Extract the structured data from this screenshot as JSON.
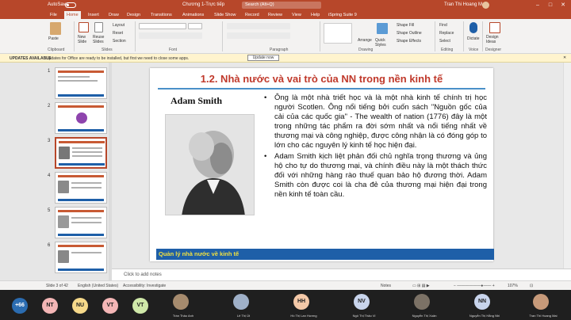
{
  "titlebar": {
    "autosave": "AutoSave",
    "autosave_state": "Off",
    "document": "Chương 1-Trực tiếp",
    "search": "Search (Alt+Q)",
    "user": "Tran Thi Hoang Mai"
  },
  "tabs": [
    "File",
    "Home",
    "Insert",
    "Draw",
    "Design",
    "Transitions",
    "Animations",
    "Slide Show",
    "Record",
    "Review",
    "View",
    "Help",
    "iSpring Suite 9"
  ],
  "ribbon": {
    "paste": "Paste",
    "new_slide": "New Slide",
    "reuse_slides": "Reuse Slides",
    "layout": "Layout",
    "reset": "Reset",
    "section": "Section",
    "shape_fill": "Shape Fill",
    "shape_outline": "Shape Outline",
    "shape_effects": "Shape Effects",
    "arrange": "Arrange",
    "quick_styles": "Quick Styles",
    "find": "Find",
    "replace": "Replace",
    "select": "Select",
    "dictate": "Dictate",
    "design_ideas": "Design Ideas",
    "groups": [
      "Clipboard",
      "Slides",
      "Font",
      "Paragraph",
      "Drawing",
      "Editing",
      "Voice",
      "Designer"
    ]
  },
  "update_bar": {
    "title": "UPDATES AVAILABLE",
    "message": "Updates for Office are ready to be installed, but first we need to close some apps.",
    "button": "Update now"
  },
  "thumbnails": [
    {
      "num": "1"
    },
    {
      "num": "2"
    },
    {
      "num": "3"
    },
    {
      "num": "4"
    },
    {
      "num": "5"
    },
    {
      "num": "6"
    }
  ],
  "slide": {
    "title": "1.2. Nhà nước và vai trò của NN trong nền kinh tế",
    "name": "Adam Smith",
    "bullets": [
      "Ông là một nhà triết học và là một nhà kinh tế chính trị học người Scotlen. Ông nổi tiếng bởi cuốn sách \"Nguồn gốc của cải của các quốc gia\" - The wealth of nation (1776) đây là một trong những tác phẩm ra đời sớm nhất và nổi tiếng nhất về thương mại và công nghiệp, được công nhận là có đóng góp to lớn cho các nguyên lý kinh tế học hiện đại.",
      "Adam Smith kịch liệt phản đối chủ nghĩa trọng thương và ủng hộ cho tự do thương mại, và chính điều này là một thách thức đối với những hàng rào thuế quan bảo hộ đương thời. Adam Smith còn được coi là cha đẻ của thương mại hiện đại trong nền kinh tế toàn cầu."
    ],
    "footer": "Quản lý nhà nước về kinh tế"
  },
  "notes_placeholder": "Click to add notes",
  "status": {
    "slide_info": "Slide 3 of 42",
    "language": "English (United States)",
    "accessibility": "Accessibility: Investigate",
    "notes": "Notes",
    "zoom": "107%"
  },
  "participants": [
    {
      "label": "+66",
      "color": "#2b6cb0",
      "kind": "count"
    },
    {
      "initials": "NT",
      "color": "#f4b6b6",
      "kind": "initials"
    },
    {
      "initials": "NU",
      "color": "#f6d98a",
      "kind": "initials"
    },
    {
      "initials": "VT",
      "color": "#f4b6b6",
      "kind": "initials"
    },
    {
      "initials": "VT",
      "color": "#cfe8a9",
      "kind": "initials"
    }
  ],
  "videos": [
    {
      "name": "Trần Thảo Anh",
      "kind": "photo"
    },
    {
      "name": "Lê Thị Út",
      "kind": "photo"
    },
    {
      "name": "Hồ Thị Lan Hương",
      "initials": "HH",
      "color": "#f4c9a8",
      "kind": "initials"
    },
    {
      "name": "Ngô Thị Thảo Vi",
      "initials": "NV",
      "color": "#c8d4ec",
      "kind": "initials"
    },
    {
      "name": "Nguyễn Thị Xuân",
      "kind": "photo"
    },
    {
      "name": "Nguyễn Thị Hằng Nhi",
      "initials": "NN",
      "color": "#c8d4ec",
      "kind": "initials"
    },
    {
      "name": "Tran Thi Hoang Mai",
      "kind": "photo"
    }
  ],
  "colors": {
    "ppt_accent": "#b7472a",
    "slide_title": "#c0392b",
    "footer_bg": "#1e5fa8",
    "footer_text": "#f0e040"
  }
}
